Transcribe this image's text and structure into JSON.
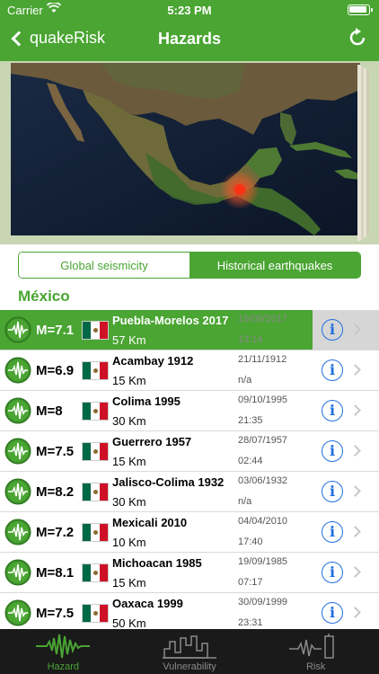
{
  "status": {
    "carrier": "Carrier",
    "time": "5:23 PM"
  },
  "nav": {
    "back_label": "quakeRisk",
    "title": "Hazards"
  },
  "segments": {
    "global": "Global seismicity",
    "historical": "Historical earthquakes",
    "selected": "historical"
  },
  "section_title": "México",
  "quakes": [
    {
      "magnitude": "M=7.1",
      "name": "Puebla-Morelos 2017",
      "distance": "57 Km",
      "date": "19/09/2017",
      "time": "13:14",
      "selected": true
    },
    {
      "magnitude": "M=6.9",
      "name": "Acambay 1912",
      "distance": "15 Km",
      "date": "21/11/1912",
      "time": "n/a"
    },
    {
      "magnitude": "M=8",
      "name": "Colima 1995",
      "distance": "30 Km",
      "date": "09/10/1995",
      "time": "21:35"
    },
    {
      "magnitude": "M=7.5",
      "name": "Guerrero 1957",
      "distance": "15 Km",
      "date": "28/07/1957",
      "time": "02:44"
    },
    {
      "magnitude": "M=8.2",
      "name": "Jalisco-Colima 1932",
      "distance": "30 Km",
      "date": "03/06/1932",
      "time": "n/a"
    },
    {
      "magnitude": "M=7.2",
      "name": "Mexicali 2010",
      "distance": "10 Km",
      "date": "04/04/2010",
      "time": "17:40"
    },
    {
      "magnitude": "M=8.1",
      "name": "Michoacan 1985",
      "distance": "15 Km",
      "date": "19/09/1985",
      "time": "07:17"
    },
    {
      "magnitude": "M=7.5",
      "name": "Oaxaca 1999",
      "distance": "50 Km",
      "date": "30/09/1999",
      "time": "23:31"
    }
  ],
  "tabs": [
    {
      "label": "Hazard",
      "icon": "seismograph-icon",
      "active": true
    },
    {
      "label": "Vulnerability",
      "icon": "buildings-icon",
      "active": false
    },
    {
      "label": "Risk",
      "icon": "risk-icon",
      "active": false
    }
  ],
  "colors": {
    "brand_green": "#4aa533",
    "link_blue": "#1f6fe0",
    "tabbar": "#1a1a1a"
  }
}
